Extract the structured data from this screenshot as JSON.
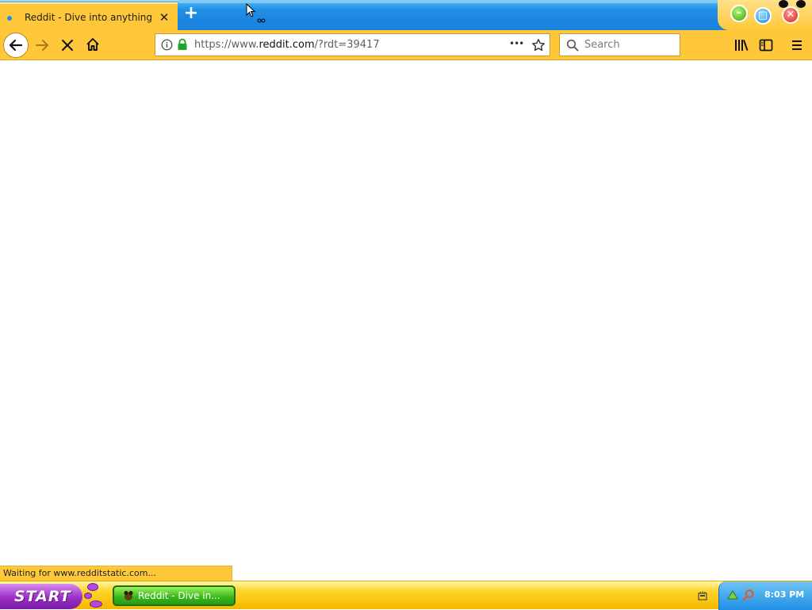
{
  "browser": {
    "tab": {
      "title": "Reddit - Dive into anything",
      "close_glyph": "✕"
    },
    "new_tab_glyph": "+",
    "url": {
      "scheme": "https://www.",
      "host": "reddit.com",
      "path": "/?rdt=39417"
    },
    "search": {
      "placeholder": "Search"
    },
    "page_actions_glyph": "•••",
    "status_text": "Waiting for www.redditstatic.com..."
  },
  "taskbar": {
    "start_label": "START",
    "task_button_label": "Reddit - Dive in...",
    "clock": "8:03 PM"
  },
  "colors": {
    "chrome_accent": "#ffc83a",
    "tabstrip_blue": "#1a84e0",
    "task_green": "#36b51a",
    "start_purple": "#9b2fc6"
  },
  "icons": {
    "tab": "favicon-icon",
    "navigation": [
      "back-arrow-icon",
      "forward-arrow-icon",
      "stop-loading-icon",
      "home-icon"
    ],
    "url_bar": [
      "info-icon",
      "lock-icon",
      "more-actions-icon",
      "bookmark-star-icon"
    ],
    "toolbar": [
      "library-icon",
      "sidebar-icon",
      "hamburger-menu-icon"
    ],
    "tray": [
      "tray-network-icon",
      "tray-search-icon",
      "tray-device-icon"
    ]
  }
}
